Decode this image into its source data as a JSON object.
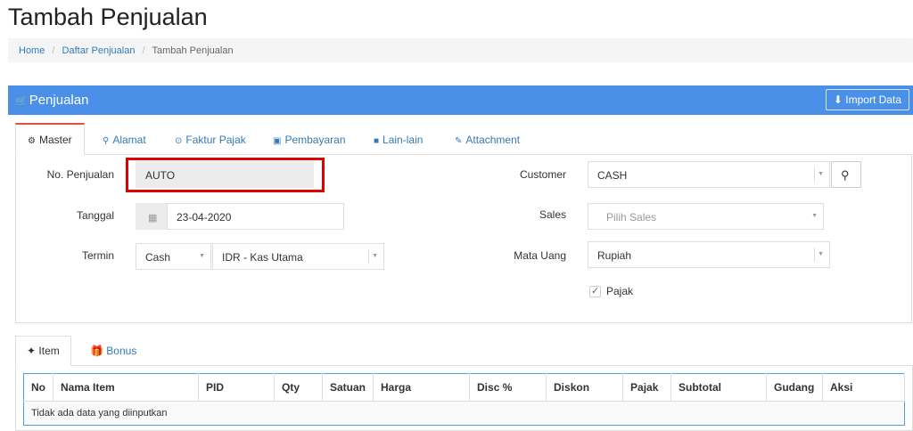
{
  "page": {
    "title": "Tambah Penjualan"
  },
  "breadcrumb": {
    "home": "Home",
    "list": "Daftar Penjualan",
    "current": "Tambah Penjualan",
    "separator": "/"
  },
  "panel": {
    "title": "Penjualan",
    "title_icon": "cart-icon",
    "import_label": "Import Data",
    "import_icon": "upload-icon",
    "color": "#4a90e8"
  },
  "tabs": [
    {
      "label": "Master",
      "icon": "cogs-icon",
      "active": true
    },
    {
      "label": "Alamat",
      "icon": "map-marker-icon"
    },
    {
      "label": "Faktur Pajak",
      "icon": "check-circle-icon"
    },
    {
      "label": "Pembayaran",
      "icon": "money-icon"
    },
    {
      "label": "Lain-lain",
      "icon": "truck-icon"
    },
    {
      "label": "Attachment",
      "icon": "paperclip-icon"
    }
  ],
  "form": {
    "no_penjualan": {
      "label": "No. Penjualan",
      "value": "AUTO"
    },
    "tanggal": {
      "label": "Tanggal",
      "value": "23-04-2020"
    },
    "termin": {
      "label": "Termin",
      "value": "Cash",
      "account": "IDR - Kas Utama"
    },
    "customer": {
      "label": "Customer",
      "value": "CASH"
    },
    "sales": {
      "label": "Sales",
      "placeholder": "Pilih Sales"
    },
    "mata_uang": {
      "label": "Mata Uang",
      "value": "Rupiah"
    },
    "pajak": {
      "label": "Pajak",
      "checked": true
    }
  },
  "item_tabs": [
    {
      "label": "Item",
      "icon": "cubes-icon",
      "active": true
    },
    {
      "label": "Bonus",
      "icon": "gift-icon"
    }
  ],
  "table": {
    "headers": [
      "No",
      "Nama Item",
      "PID",
      "Qty",
      "Satuan",
      "Harga",
      "Disc %",
      "Diskon",
      "Pajak",
      "Subtotal",
      "Gudang",
      "Aksi"
    ],
    "empty_text": "Tidak ada data yang diinputkan"
  },
  "colors": {
    "accent": "#337ab7",
    "highlight": "#e00000",
    "active_tab_border": "#e74c3c"
  }
}
